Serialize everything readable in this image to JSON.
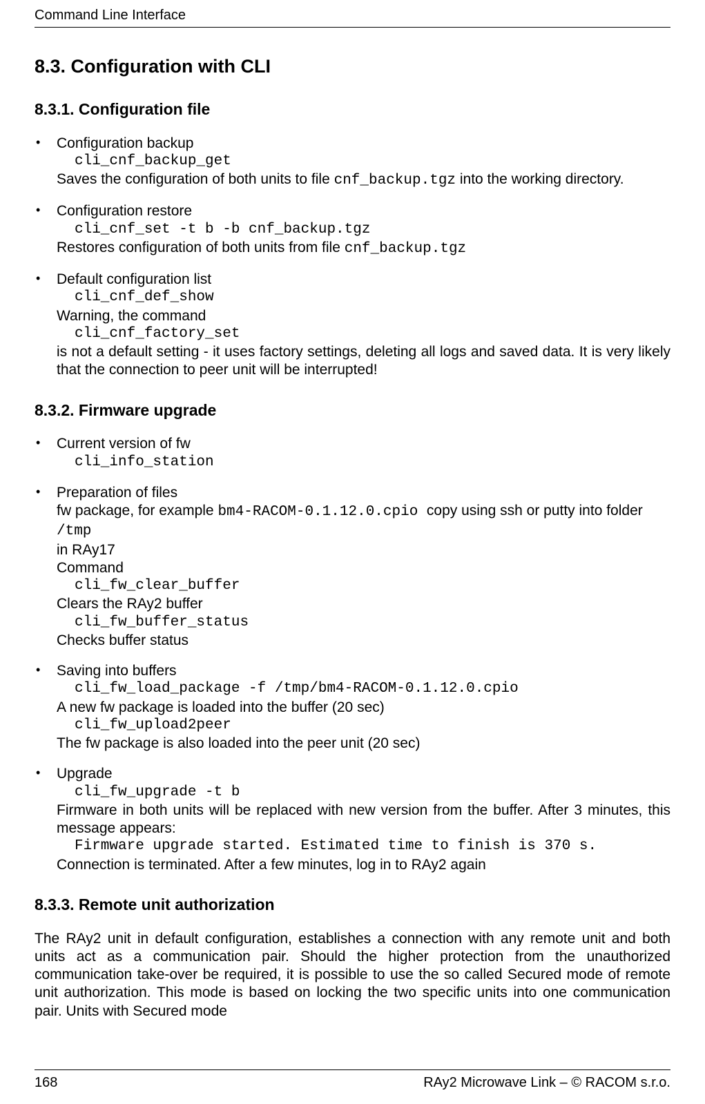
{
  "header": {
    "running": "Command Line Interface"
  },
  "sections": {
    "s83": {
      "title": "8.3. Configuration with CLI"
    },
    "s831": {
      "title": "8.3.1. Configuration file",
      "items": [
        {
          "lead": "Configuration backup",
          "cmd1": "cli_cnf_backup_get",
          "desc1a": "Saves the configuration of both units to file ",
          "code1": "cnf_backup.tgz",
          "desc1b": " into the working directory."
        },
        {
          "lead": "Configuration restore",
          "cmd1": "cli_cnf_set -t b -b cnf_backup.tgz",
          "desc1a": "Restores configuration of both units from file ",
          "code1": "cnf_backup.tgz",
          "desc1b": ""
        },
        {
          "lead": "Default configuration list",
          "cmd1": "cli_cnf_def_show",
          "mid": "Warning, the command",
          "cmd2": "cli_cnf_factory_set",
          "desc2": "is not a default setting - it uses factory settings, deleting all logs and saved data. It is very likely that the connection to peer unit will be interrupted!"
        }
      ]
    },
    "s832": {
      "title": "8.3.2. Firmware upgrade",
      "items": [
        {
          "lead": "Current version of fw",
          "cmd1": "cli_info_station"
        },
        {
          "lead": "Preparation of files",
          "line1a": "fw package, for example ",
          "code1": " bm4-RACOM-0.1.12.0.cpio ",
          "line1b": " copy using ssh or putty into folder ",
          "code2": "/tmp",
          "line2": "in RAy17",
          "line3": "Command",
          "cmd1": "cli_fw_clear_buffer",
          "line4": "Clears the RAy2 buffer",
          "cmd2": "cli_fw_buffer_status",
          "line5": "Checks buffer status"
        },
        {
          "lead": "Saving into buffers",
          "cmd1": "cli_fw_load_package -f /tmp/bm4-RACOM-0.1.12.0.cpio",
          "line1": "A new fw package is loaded into the buffer (20 sec)",
          "cmd2": "cli_fw_upload2peer",
          "line2": "The fw package is also loaded into the peer unit (20 sec)"
        },
        {
          "lead": "Upgrade",
          "cmd1": "cli_fw_upgrade -t b",
          "line1": "Firmware in both units will be replaced with new version from the buffer. After 3 minutes, this message appears:",
          "cmd2": "Firmware upgrade started. Estimated time to finish is 370 s.",
          "line2": "Connection is terminated. After a few minutes, log in to RAy2 again"
        }
      ]
    },
    "s833": {
      "title": "8.3.3. Remote unit authorization",
      "para": "The RAy2 unit in default configuration, establishes a connection with any remote unit and both units act as a communication pair. Should the higher protection from the unauthorized communication take-over be required, it is possible to use the so called Secured mode of remote unit authorization. This mode is based on locking the two specific units into one communication pair. Units with Secured mode"
    }
  },
  "footer": {
    "page": "168",
    "right": "RAy2 Microwave Link – © RACOM s.r.o."
  }
}
